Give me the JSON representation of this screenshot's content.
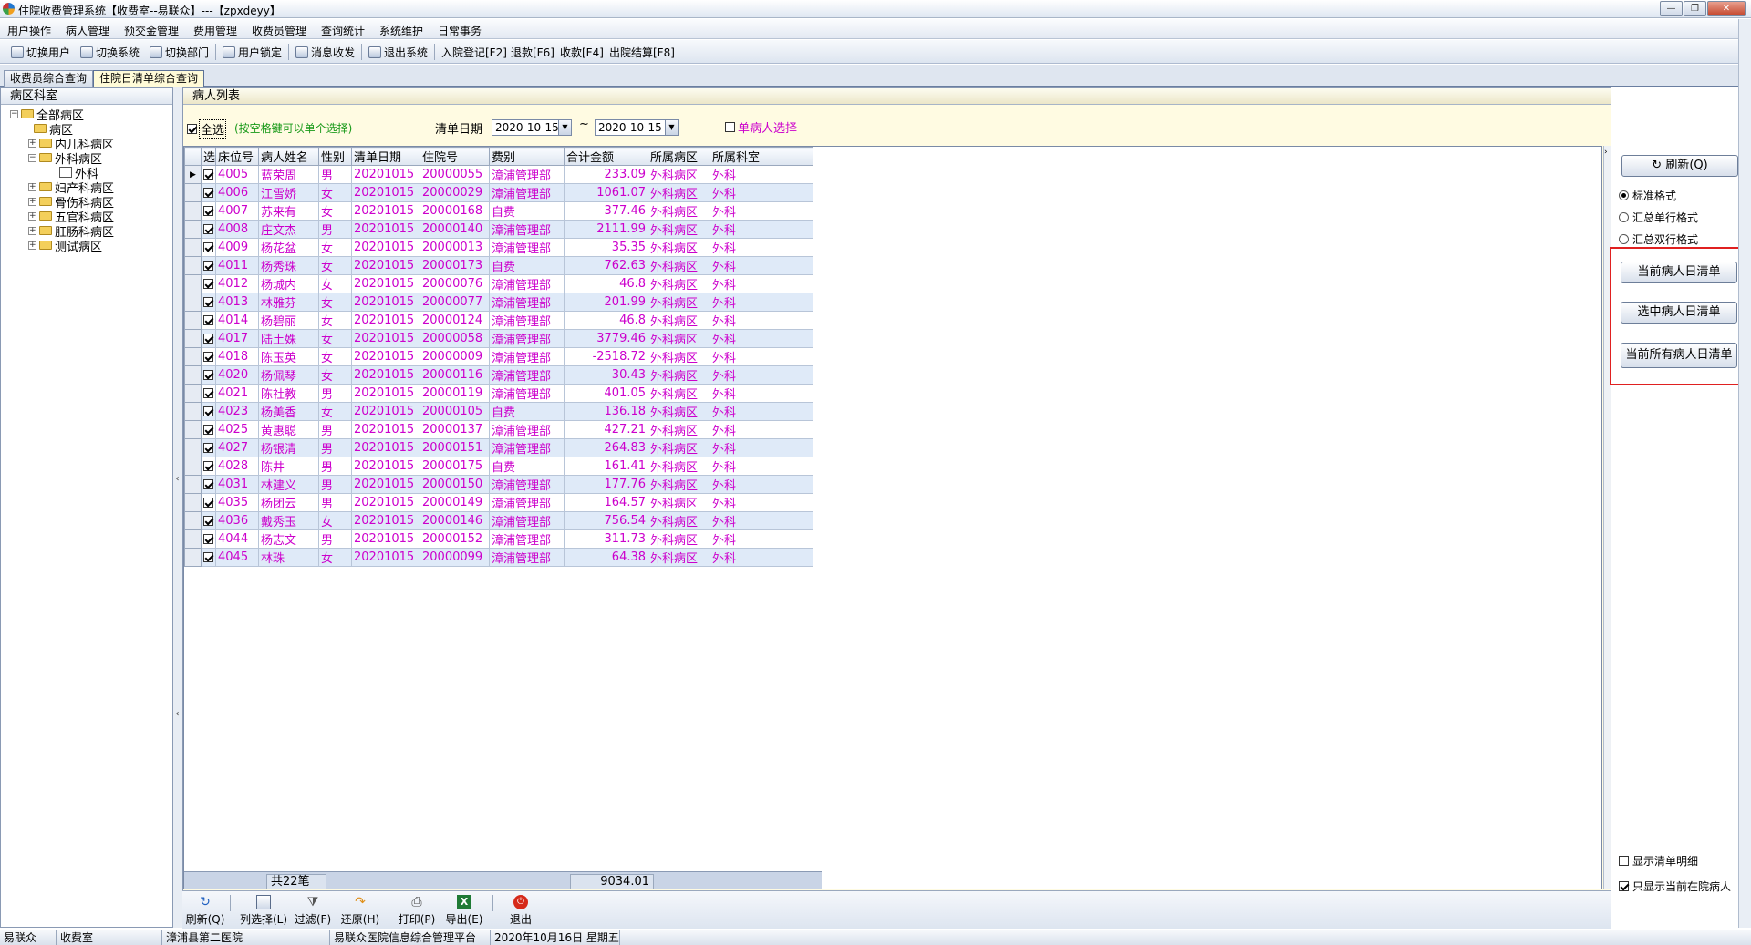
{
  "window": {
    "title": "住院收费管理系统【收费室--易联众】---【zpxdeyy】"
  },
  "menu": [
    "用户操作",
    "病人管理",
    "预交金管理",
    "费用管理",
    "收费员管理",
    "查询统计",
    "系统维护",
    "日常事务"
  ],
  "toolbar": {
    "switch_user": "切换用户",
    "switch_system": "切换系统",
    "switch_dept": "切换部门",
    "user_lock": "用户锁定",
    "message": "消息收发",
    "exit_system": "退出系统",
    "admit": "入院登记[F2]",
    "refund": "退款[F6]",
    "charge": "收款[F4]",
    "discharge": "出院结算[F8]"
  },
  "tabs": [
    "收费员综合查询",
    "住院日清单综合查询"
  ],
  "left": {
    "header": "病区科室",
    "tree": [
      "全部病区",
      "病区",
      "内儿科病区",
      "外科病区",
      "外科",
      "妇产科病区",
      "骨伤科病区",
      "五官科病区",
      "肛肠科病区",
      "测试病区"
    ]
  },
  "main": {
    "header": "病人列表",
    "select_all": "全选",
    "hint": "(按空格键可以单个选择)",
    "date_label": "清单日期",
    "date_from": "2020-10-15",
    "tilde": "~",
    "date_to": "2020-10-15",
    "single_patient": "单病人选择"
  },
  "grid": {
    "headers": [
      "选",
      "床位号",
      "病人姓名",
      "性别",
      "清单日期",
      "住院号",
      "费别",
      "合计金额",
      "所属病区",
      "所属科室"
    ],
    "rows": [
      [
        "4005",
        "蓝荣周",
        "男",
        "20201015",
        "20000055",
        "漳浦管理部",
        "233.09",
        "外科病区",
        "外科"
      ],
      [
        "4006",
        "江雪娇",
        "女",
        "20201015",
        "20000029",
        "漳浦管理部",
        "1061.07",
        "外科病区",
        "外科"
      ],
      [
        "4007",
        "苏来有",
        "女",
        "20201015",
        "20000168",
        "自费",
        "377.46",
        "外科病区",
        "外科"
      ],
      [
        "4008",
        "庄文杰",
        "男",
        "20201015",
        "20000140",
        "漳浦管理部",
        "2111.99",
        "外科病区",
        "外科"
      ],
      [
        "4009",
        "杨花盆",
        "女",
        "20201015",
        "20000013",
        "漳浦管理部",
        "35.35",
        "外科病区",
        "外科"
      ],
      [
        "4011",
        "杨秀珠",
        "女",
        "20201015",
        "20000173",
        "自费",
        "762.63",
        "外科病区",
        "外科"
      ],
      [
        "4012",
        "杨城内",
        "女",
        "20201015",
        "20000076",
        "漳浦管理部",
        "46.8",
        "外科病区",
        "外科"
      ],
      [
        "4013",
        "林雅芬",
        "女",
        "20201015",
        "20000077",
        "漳浦管理部",
        "201.99",
        "外科病区",
        "外科"
      ],
      [
        "4014",
        "杨碧丽",
        "女",
        "20201015",
        "20000124",
        "漳浦管理部",
        "46.8",
        "外科病区",
        "外科"
      ],
      [
        "4017",
        "陆土姝",
        "女",
        "20201015",
        "20000058",
        "漳浦管理部",
        "3779.46",
        "外科病区",
        "外科"
      ],
      [
        "4018",
        "陈玉英",
        "女",
        "20201015",
        "20000009",
        "漳浦管理部",
        "-2518.72",
        "外科病区",
        "外科"
      ],
      [
        "4020",
        "杨佩琴",
        "女",
        "20201015",
        "20000116",
        "漳浦管理部",
        "30.43",
        "外科病区",
        "外科"
      ],
      [
        "4021",
        "陈社教",
        "男",
        "20201015",
        "20000119",
        "漳浦管理部",
        "401.05",
        "外科病区",
        "外科"
      ],
      [
        "4023",
        "杨美香",
        "女",
        "20201015",
        "20000105",
        "自费",
        "136.18",
        "外科病区",
        "外科"
      ],
      [
        "4025",
        "黄惠聪",
        "男",
        "20201015",
        "20000137",
        "漳浦管理部",
        "427.21",
        "外科病区",
        "外科"
      ],
      [
        "4027",
        "杨银清",
        "男",
        "20201015",
        "20000151",
        "漳浦管理部",
        "264.83",
        "外科病区",
        "外科"
      ],
      [
        "4028",
        "陈井",
        "男",
        "20201015",
        "20000175",
        "自费",
        "161.41",
        "外科病区",
        "外科"
      ],
      [
        "4031",
        "林建义",
        "男",
        "20201015",
        "20000150",
        "漳浦管理部",
        "177.76",
        "外科病区",
        "外科"
      ],
      [
        "4035",
        "杨团云",
        "男",
        "20201015",
        "20000149",
        "漳浦管理部",
        "164.57",
        "外科病区",
        "外科"
      ],
      [
        "4036",
        "戴秀玉",
        "女",
        "20201015",
        "20000146",
        "漳浦管理部",
        "756.54",
        "外科病区",
        "外科"
      ],
      [
        "4044",
        "杨志文",
        "男",
        "20201015",
        "20000152",
        "漳浦管理部",
        "311.73",
        "外科病区",
        "外科"
      ],
      [
        "4045",
        "林珠",
        "女",
        "20201015",
        "20000099",
        "漳浦管理部",
        "64.38",
        "外科病区",
        "外科"
      ]
    ],
    "footer_count": "共22笔",
    "footer_total": "9034.01"
  },
  "right": {
    "refresh": "刷新(Q)",
    "opt_standard": "标准格式",
    "opt_single": "汇总单行格式",
    "opt_double": "汇总双行格式",
    "btn_current": "当前病人日清单",
    "btn_selected": "选中病人日清单",
    "btn_all": "当前所有病人日清单",
    "show_detail": "显示清单明细",
    "only_inhosp": "只显示当前在院病人"
  },
  "bottom": {
    "refresh": "刷新(Q)",
    "columns": "列选择(L)",
    "filter": "过滤(F)",
    "restore": "还原(H)",
    "print": "打印(P)",
    "export": "导出(E)",
    "exit": "退出"
  },
  "status": {
    "s1": "易联众",
    "s2": "收费室",
    "s3": "漳浦县第二医院",
    "s4": "易联众医院信息综合管理平台",
    "s5": "2020年10月16日 星期五"
  },
  "colors": {
    "row_text": "#cc00cc",
    "highlight_box": "#e02020"
  }
}
